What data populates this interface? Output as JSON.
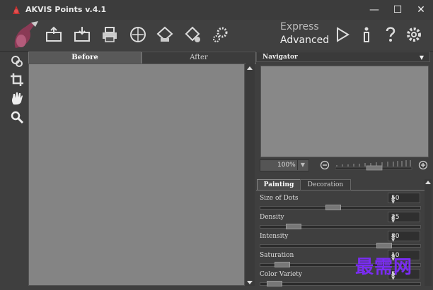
{
  "window": {
    "title": "AKVIS Points v.4.1",
    "minimize": "—",
    "maximize": "☐",
    "close": "✕"
  },
  "modes": {
    "express": "Express",
    "advanced": "Advanced"
  },
  "toolbar": {
    "icons": [
      "logo-brush-icon",
      "open-image-icon",
      "save-image-icon",
      "print-icon",
      "share-icon",
      "batch-processing-icon",
      "presets-icon",
      "settings-gear-icon"
    ],
    "right_icons": [
      "run-play-icon",
      "info-icon",
      "help-icon",
      "preferences-gear-icon"
    ]
  },
  "tools": [
    "effect-area-tool-icon",
    "crop-tool-icon",
    "hand-tool-icon",
    "zoom-tool-icon"
  ],
  "tabs": {
    "before": "Before",
    "after": "After"
  },
  "navigator": {
    "title": "Navigator",
    "zoom": "100%",
    "zoom_dropdown": "▼"
  },
  "panel": {
    "tabs": {
      "painting": "Painting",
      "decoration": "Decoration"
    },
    "params": [
      {
        "label": "Size of Dots",
        "value": "50",
        "fraction": 0.45
      },
      {
        "label": "Density",
        "value": "25",
        "fraction": 0.18
      },
      {
        "label": "Intensity",
        "value": "80",
        "fraction": 0.8
      },
      {
        "label": "Saturation",
        "value": "10",
        "fraction": 0.1
      },
      {
        "label": "Color Variety",
        "value": "5",
        "fraction": 0.05
      }
    ]
  },
  "watermark": "最需网"
}
